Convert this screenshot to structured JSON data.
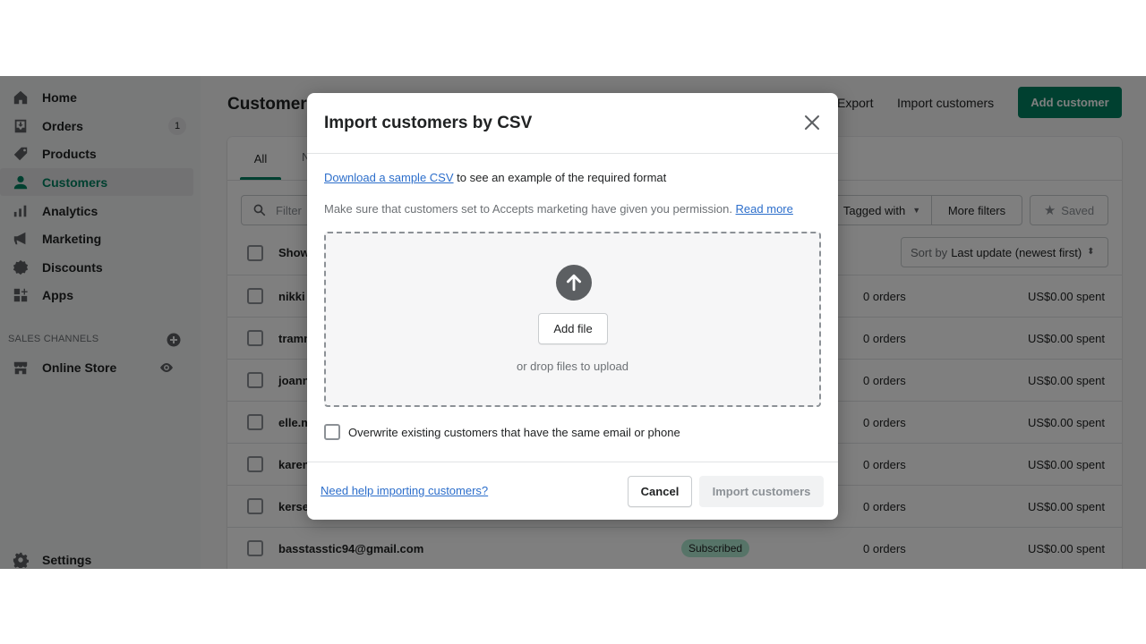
{
  "sidebar": {
    "items": [
      {
        "label": "Home",
        "icon": "home-icon"
      },
      {
        "label": "Orders",
        "icon": "orders-icon",
        "badge": "1"
      },
      {
        "label": "Products",
        "icon": "tag-icon"
      },
      {
        "label": "Customers",
        "icon": "person-icon",
        "active": true
      },
      {
        "label": "Analytics",
        "icon": "bar-chart-icon"
      },
      {
        "label": "Marketing",
        "icon": "megaphone-icon"
      },
      {
        "label": "Discounts",
        "icon": "discount-icon"
      },
      {
        "label": "Apps",
        "icon": "apps-icon"
      }
    ],
    "sales_channels_title": "SALES CHANNELS",
    "online_store": "Online Store",
    "settings": "Settings"
  },
  "header": {
    "title": "Customers",
    "export_label": "Export",
    "import_label": "Import customers",
    "add_label": "Add customer"
  },
  "card": {
    "tabs": [
      "All",
      "N"
    ],
    "filter_placeholder": "Filter",
    "tagged_with": "Tagged with",
    "more_filters": "More filters",
    "saved": "Saved",
    "sort_prefix": "Sort by",
    "sort_value": "Last update (newest first)",
    "show_all_label": "Show",
    "rows": [
      {
        "email": "nikki",
        "orders": "0 orders",
        "spent": "US$0.00 spent"
      },
      {
        "email": "tramm",
        "orders": "0 orders",
        "spent": "US$0.00 spent"
      },
      {
        "email": "joann",
        "orders": "0 orders",
        "spent": "US$0.00 spent"
      },
      {
        "email": "elle.m",
        "orders": "0 orders",
        "spent": "US$0.00 spent"
      },
      {
        "email": "karen",
        "orders": "0 orders",
        "spent": "US$0.00 spent"
      },
      {
        "email": "kerse",
        "orders": "0 orders",
        "spent": "US$0.00 spent"
      },
      {
        "email": "basstasstic94@gmail.com",
        "badge": "Subscribed",
        "orders": "0 orders",
        "spent": "US$0.00 spent"
      }
    ]
  },
  "modal": {
    "title": "Import customers by CSV",
    "download_link": "Download a sample CSV",
    "download_rest": " to see an example of the required format",
    "permission_text": "Make sure that customers set to Accepts marketing have given you permission. ",
    "read_more": "Read more",
    "add_file": "Add file",
    "drop_hint": "or drop files to upload",
    "overwrite_label": "Overwrite existing customers that have the same email or phone",
    "overwrite_checked": false,
    "help_link": "Need help importing customers?",
    "cancel": "Cancel",
    "import": "Import customers"
  },
  "colors": {
    "accent": "#008060",
    "link": "#2c6ecb",
    "badge_success": "#aee9d1"
  }
}
